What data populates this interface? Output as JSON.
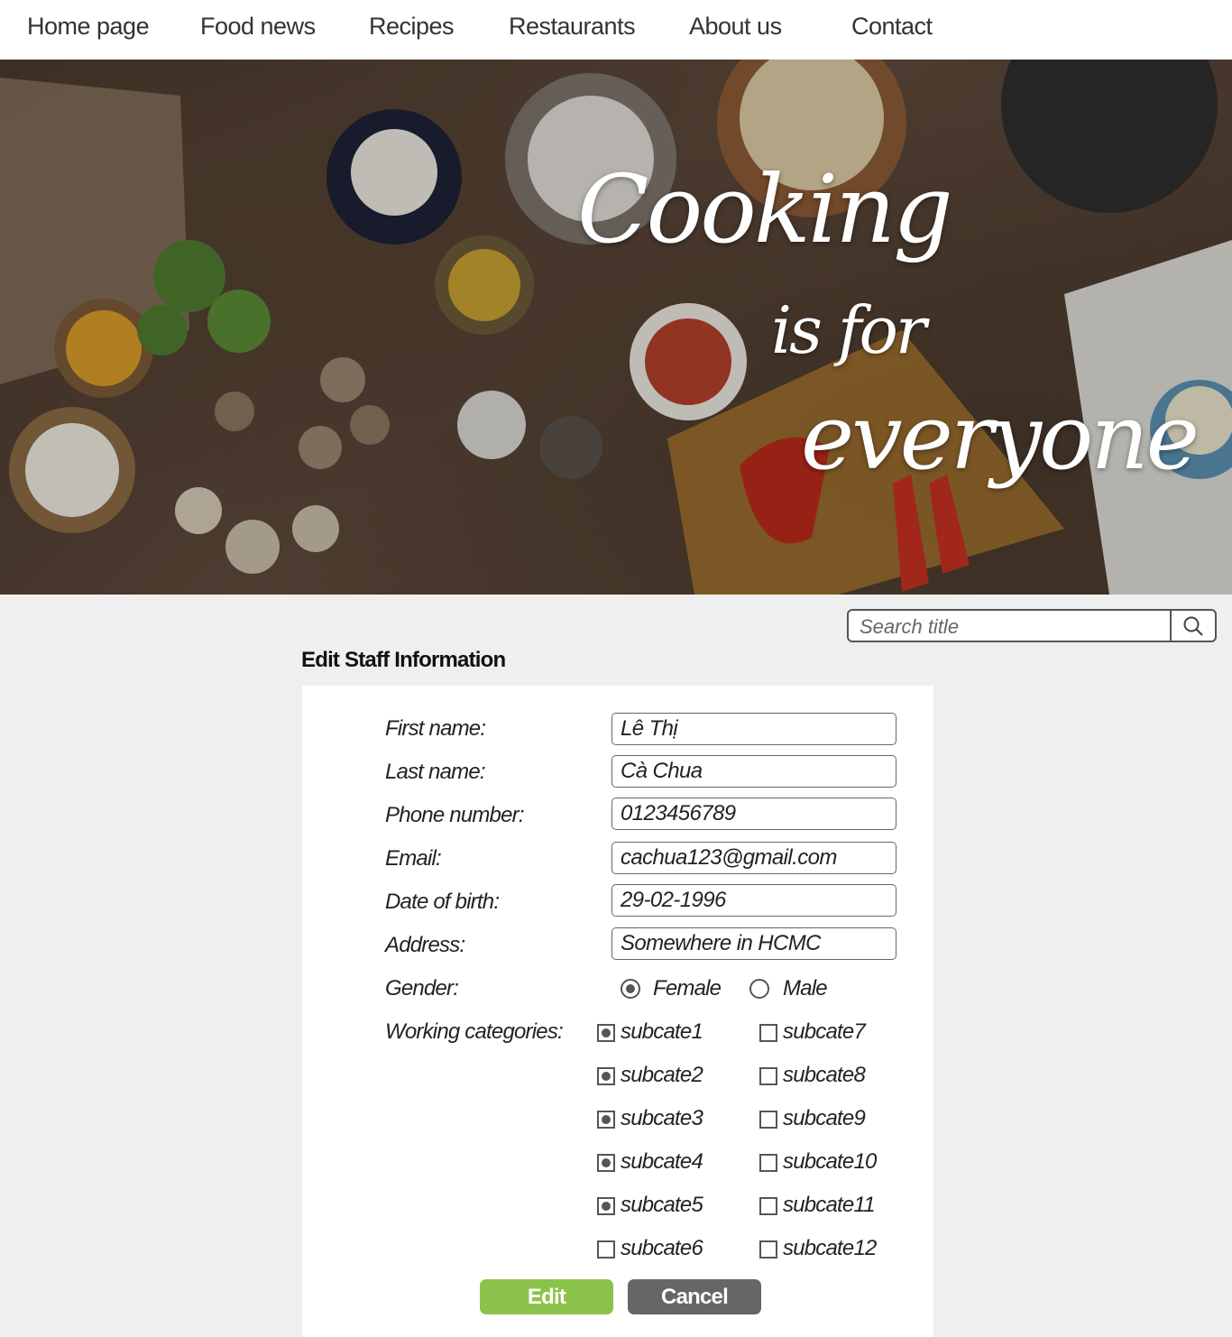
{
  "nav": {
    "items": [
      "Home page",
      "Food news",
      "Recipes",
      "Restaurants",
      "About us",
      "Contact"
    ]
  },
  "hero": {
    "line1": "Cooking",
    "line2": "is for",
    "line3": "everyone"
  },
  "search": {
    "placeholder": "Search title",
    "icon": "search-icon"
  },
  "form": {
    "title": "Edit Staff Information",
    "fields": [
      {
        "label": "First name:",
        "value": "Lê Thị"
      },
      {
        "label": "Last name:",
        "value": "Cà Chua"
      },
      {
        "label": "Phone number:",
        "value": "0123456789"
      },
      {
        "label": "Email:",
        "value": "cachua123@gmail.com"
      },
      {
        "label": "Date of birth:",
        "value": "29-02-1996"
      },
      {
        "label": "Address:",
        "value": "Somewhere in HCMC"
      }
    ],
    "gender": {
      "label": "Gender:",
      "options": [
        {
          "label": "Female",
          "selected": true
        },
        {
          "label": "Male",
          "selected": false
        }
      ]
    },
    "categories": {
      "label": "Working categories:",
      "items": [
        {
          "label": "subcate1",
          "checked": true
        },
        {
          "label": "subcate2",
          "checked": true
        },
        {
          "label": "subcate3",
          "checked": true
        },
        {
          "label": "subcate4",
          "checked": true
        },
        {
          "label": "subcate5",
          "checked": true
        },
        {
          "label": "subcate6",
          "checked": false
        },
        {
          "label": "subcate7",
          "checked": false
        },
        {
          "label": "subcate8",
          "checked": false
        },
        {
          "label": "subcate9",
          "checked": false
        },
        {
          "label": "subcate10",
          "checked": false
        },
        {
          "label": "subcate11",
          "checked": false
        },
        {
          "label": "subcate12",
          "checked": false
        }
      ]
    },
    "buttons": {
      "edit": "Edit",
      "cancel": "Cancel"
    }
  },
  "colors": {
    "edit_button": "#8bc34a",
    "cancel_button": "#666666",
    "page_background": "#efefef"
  }
}
